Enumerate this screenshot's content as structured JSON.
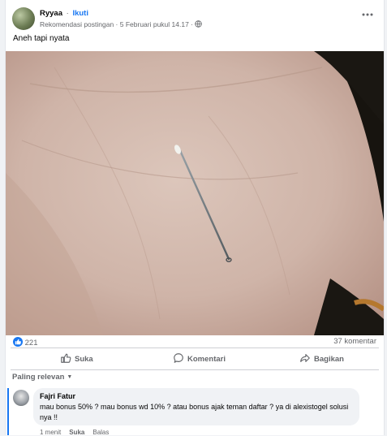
{
  "post": {
    "author": "Ryyaa",
    "separator": "·",
    "follow_label": "Ikuti",
    "meta_text": "Rekomendasi postingan · 5 Februari pukul 14.17 ·",
    "caption": "Aneh tapi nyata",
    "icons": {
      "privacy": "globe-icon",
      "more": "more-dots-icon"
    }
  },
  "stats": {
    "reaction_count": "221",
    "comment_count": "37 komentar",
    "reaction_icon": "like-icon"
  },
  "actions": {
    "like_label": "Suka",
    "comment_label": "Komentari",
    "share_label": "Bagikan"
  },
  "comments_section": {
    "sort_label": "Paling relevan",
    "comment": {
      "author": "Fajri Fatur",
      "text": "mau bonus 50% ? mau bonus wd 10% ? atau bonus ajak teman daftar ? ya di alexistogel solusi nya !!",
      "time": "1 menit",
      "like_label": "Suka",
      "reply_label": "Balas"
    }
  },
  "colors": {
    "accent": "#1877f2",
    "secondary_text": "#65676b",
    "background": "#f0f2f5"
  }
}
